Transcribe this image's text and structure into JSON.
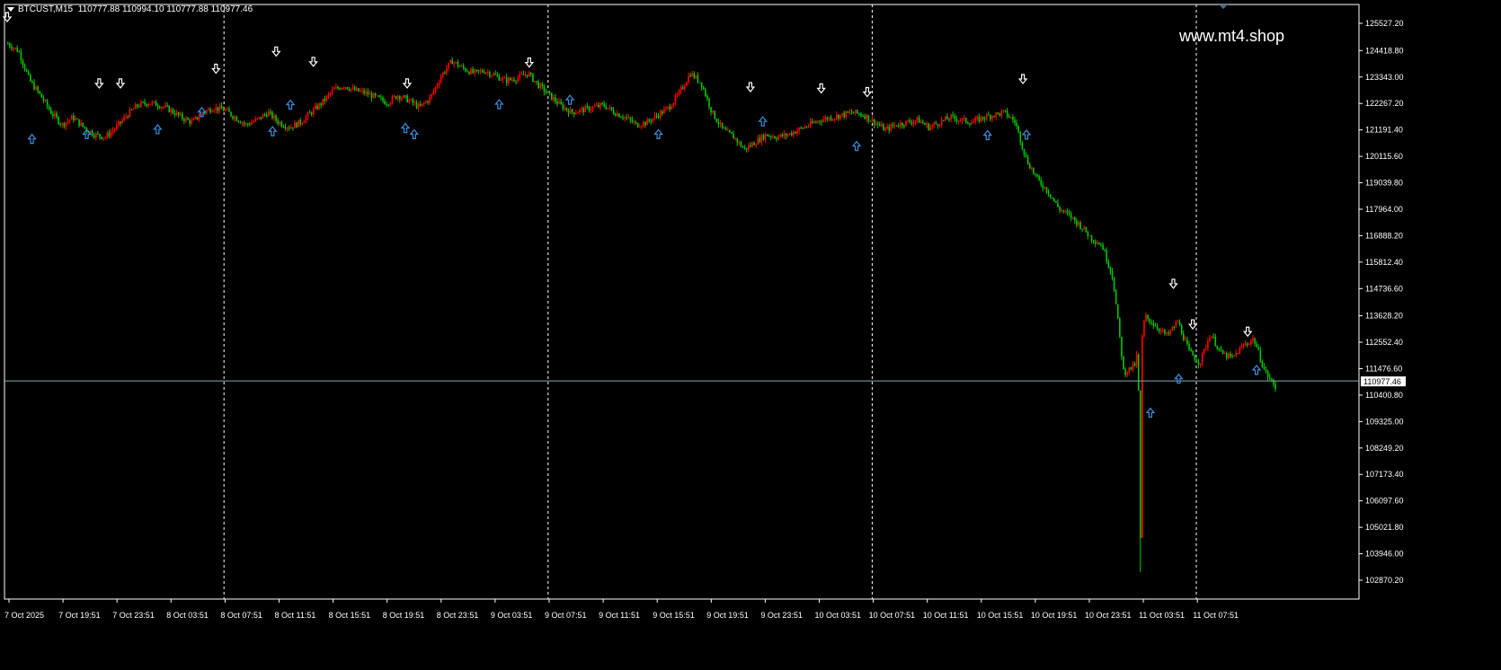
{
  "header": {
    "symbol_timeframe": "BTCUST,M15",
    "ohlc": "110777.88 110994.10 110777.88 110977.46"
  },
  "watermark": "www.mt4.shop",
  "current_price_label": "110977.46",
  "colors": {
    "background": "#000000",
    "bull": "#ff0000",
    "bear": "#00c800",
    "grid": "#ffffff",
    "axis": "#ffffff",
    "price_line": "#8aa6b8",
    "up_arrow": "#3b8fe0",
    "down_arrow": "#ffffff"
  },
  "chart_data": {
    "type": "candlestick",
    "symbol": "BTCUST",
    "timeframe": "M15",
    "y_ticks": [
      "125527.20",
      "124418.80",
      "123343.00",
      "122267.20",
      "121191.40",
      "120115.60",
      "119039.80",
      "117964.00",
      "116888.20",
      "115812.40",
      "114736.60",
      "113628.20",
      "112552.40",
      "111476.60",
      "110400.80",
      "109325.00",
      "108249.20",
      "107173.40",
      "106097.60",
      "105021.80",
      "103946.00",
      "102870.20"
    ],
    "ylim": [
      102870.2,
      125527.2
    ],
    "x_ticks": [
      "7 Oct 2025",
      "7 Oct 19:51",
      "7 Oct 23:51",
      "8 Oct 03:51",
      "8 Oct 07:51",
      "8 Oct 11:51",
      "8 Oct 15:51",
      "8 Oct 19:51",
      "8 Oct 23:51",
      "9 Oct 03:51",
      "9 Oct 07:51",
      "9 Oct 11:51",
      "9 Oct 15:51",
      "9 Oct 19:51",
      "9 Oct 23:51",
      "10 Oct 03:51",
      "10 Oct 07:51",
      "10 Oct 11:51",
      "10 Oct 15:51",
      "10 Oct 19:51",
      "10 Oct 23:51",
      "11 Oct 03:51",
      "11 Oct 07:51"
    ],
    "day_separators": [
      "7 Oct 23:51",
      "8 Oct 23:51",
      "9 Oct 23:51",
      "10 Oct 23:51"
    ],
    "current_price": 110977.46,
    "close_path": [
      [
        0,
        124700
      ],
      [
        1,
        124400
      ],
      [
        2,
        123200
      ],
      [
        3,
        122600
      ],
      [
        4,
        121900
      ],
      [
        5,
        121400
      ],
      [
        6,
        121700
      ],
      [
        7,
        121300
      ],
      [
        8,
        121000
      ],
      [
        9,
        120900
      ],
      [
        10,
        121300
      ],
      [
        11,
        121800
      ],
      [
        12,
        122200
      ],
      [
        13,
        122300
      ],
      [
        14,
        122200
      ],
      [
        15,
        122000
      ],
      [
        16,
        121700
      ],
      [
        17,
        121500
      ],
      [
        18,
        121900
      ],
      [
        19,
        122100
      ],
      [
        20,
        122000
      ],
      [
        21,
        121700
      ],
      [
        22,
        121400
      ],
      [
        23,
        121600
      ],
      [
        24,
        121900
      ],
      [
        25,
        121500
      ],
      [
        26,
        121300
      ],
      [
        27,
        121500
      ],
      [
        28,
        121900
      ],
      [
        29,
        122300
      ],
      [
        30,
        122800
      ],
      [
        31,
        123000
      ],
      [
        32,
        122800
      ],
      [
        33,
        122700
      ],
      [
        34,
        122500
      ],
      [
        35,
        122300
      ],
      [
        36,
        122600
      ],
      [
        37,
        122400
      ],
      [
        38,
        122100
      ],
      [
        39,
        122500
      ],
      [
        40,
        123400
      ],
      [
        41,
        124000
      ],
      [
        42,
        123700
      ],
      [
        43,
        123500
      ],
      [
        44,
        123600
      ],
      [
        45,
        123400
      ],
      [
        46,
        123200
      ],
      [
        47,
        123300
      ],
      [
        48,
        123500
      ],
      [
        49,
        123000
      ],
      [
        50,
        122600
      ],
      [
        51,
        122200
      ],
      [
        52,
        121900
      ],
      [
        53,
        122000
      ],
      [
        54,
        122100
      ],
      [
        55,
        122200
      ],
      [
        56,
        121900
      ],
      [
        57,
        121700
      ],
      [
        58,
        121400
      ],
      [
        59,
        121500
      ],
      [
        60,
        121800
      ],
      [
        61,
        122100
      ],
      [
        62,
        122700
      ],
      [
        63,
        123500
      ],
      [
        64,
        123100
      ],
      [
        65,
        121900
      ],
      [
        66,
        121200
      ],
      [
        67,
        120900
      ],
      [
        68,
        120400
      ],
      [
        69,
        120700
      ],
      [
        70,
        121000
      ],
      [
        71,
        120900
      ],
      [
        72,
        121000
      ],
      [
        73,
        121200
      ],
      [
        74,
        121400
      ],
      [
        75,
        121600
      ],
      [
        76,
        121700
      ],
      [
        77,
        121800
      ],
      [
        78,
        121900
      ],
      [
        79,
        121800
      ],
      [
        80,
        121500
      ],
      [
        81,
        121200
      ],
      [
        82,
        121400
      ],
      [
        83,
        121500
      ],
      [
        84,
        121600
      ],
      [
        85,
        121300
      ],
      [
        86,
        121500
      ],
      [
        87,
        121700
      ],
      [
        88,
        121600
      ],
      [
        89,
        121500
      ],
      [
        90,
        121700
      ],
      [
        91,
        121800
      ],
      [
        92,
        121900
      ],
      [
        93,
        121500
      ],
      [
        94,
        120000
      ],
      [
        95,
        119200
      ],
      [
        96,
        118700
      ],
      [
        97,
        118000
      ],
      [
        98,
        117700
      ],
      [
        99,
        117300
      ],
      [
        100,
        116800
      ],
      [
        101,
        116500
      ],
      [
        102,
        115200
      ],
      [
        103,
        111300
      ],
      [
        104,
        111600
      ],
      [
        105,
        113600
      ],
      [
        106,
        113200
      ],
      [
        107,
        112800
      ],
      [
        108,
        113400
      ],
      [
        109,
        112200
      ],
      [
        110,
        111700
      ],
      [
        111,
        112900
      ],
      [
        112,
        112100
      ],
      [
        113,
        111900
      ],
      [
        114,
        112400
      ],
      [
        115,
        112700
      ],
      [
        116,
        111400
      ],
      [
        117,
        110700
      ]
    ],
    "up_signals": [
      [
        14,
        121010
      ],
      [
        45,
        121200
      ],
      [
        85,
        121400
      ],
      [
        110,
        122100
      ],
      [
        150,
        121320
      ],
      [
        160,
        122400
      ],
      [
        225,
        121450
      ],
      [
        230,
        121200
      ],
      [
        278,
        122420
      ],
      [
        318,
        122600
      ],
      [
        368,
        121200
      ],
      [
        427,
        121720
      ],
      [
        480,
        120720
      ],
      [
        554,
        121160
      ],
      [
        576,
        121180
      ],
      [
        646,
        109870
      ],
      [
        662,
        111250
      ],
      [
        706,
        111610
      ]
    ],
    "down_signals": [
      [
        0,
        125600
      ],
      [
        52,
        122900
      ],
      [
        64,
        122900
      ],
      [
        118,
        123500
      ],
      [
        152,
        124200
      ],
      [
        173,
        123780
      ],
      [
        226,
        122900
      ],
      [
        295,
        123750
      ],
      [
        420,
        122750
      ],
      [
        460,
        122700
      ],
      [
        486,
        122550
      ],
      [
        574,
        123080
      ],
      [
        659,
        114750
      ],
      [
        670,
        113100
      ],
      [
        701,
        112800
      ]
    ],
    "n_bars": 720,
    "plot_area": {
      "note": "rendered via script"
    }
  }
}
